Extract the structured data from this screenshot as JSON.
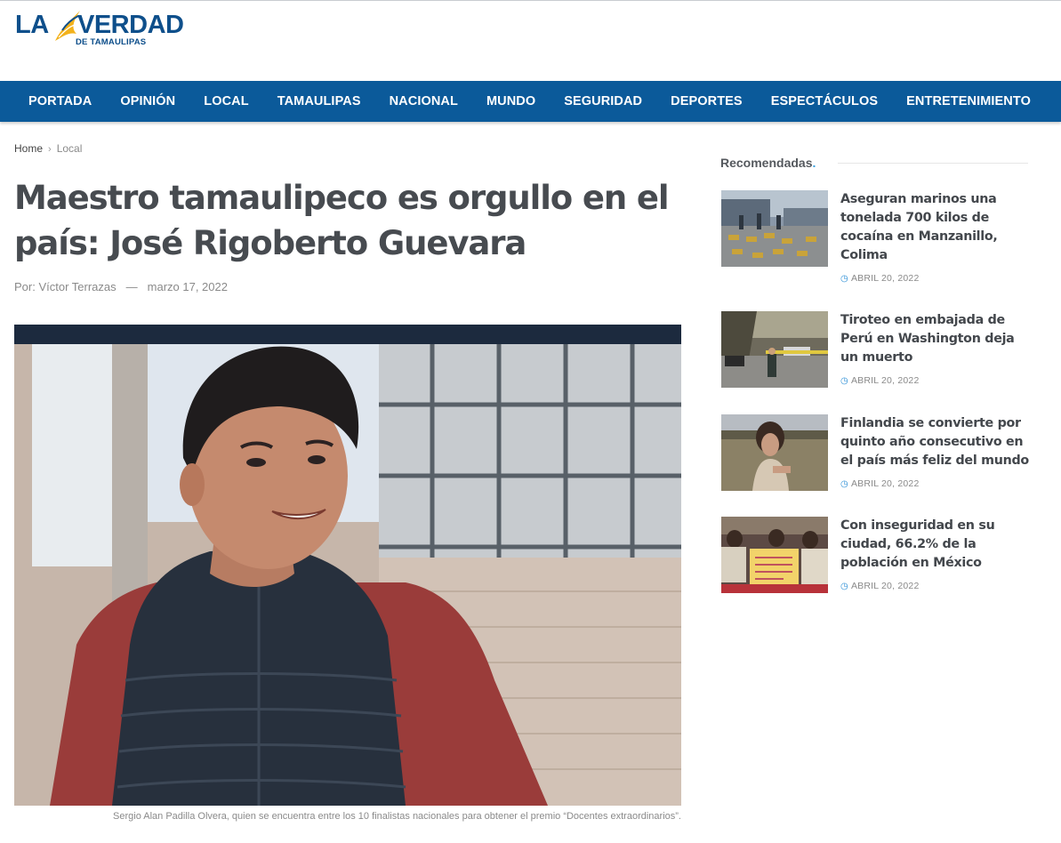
{
  "site": {
    "logo_la": "LA",
    "logo_verdad": "VERDAD",
    "logo_sub": "DE TAMAULIPAS"
  },
  "nav": {
    "items": [
      "PORTADA",
      "OPINIÓN",
      "LOCAL",
      "TAMAULIPAS",
      "NACIONAL",
      "MUNDO",
      "SEGURIDAD",
      "DEPORTES",
      "ESPECTÁCULOS",
      "ENTRETENIMIENTO"
    ]
  },
  "breadcrumb": {
    "home": "Home",
    "separator": "›",
    "current": "Local"
  },
  "article": {
    "title": "Maestro tamaulipeco es orgullo en el país: José Rigoberto Guevara",
    "author": "Por: Víctor Terrazas",
    "dash": "—",
    "date": "marzo 17, 2022",
    "caption": "Sergio Alan Padilla Olvera, quien se encuentra entre los 10 finalistas nacionales para obtener el premio “Docentes extraordinarios”."
  },
  "sidebar": {
    "heading": "Recomendadas",
    "heading_dot": ".",
    "items": [
      {
        "title": "Aseguran marinos una tonelada 700 kilos de cocaína en Manzanillo, Colima",
        "date": "ABRIL 20, 2022"
      },
      {
        "title": "Tiroteo en embajada de Perú en Washington deja un muerto",
        "date": "ABRIL 20, 2022"
      },
      {
        "title": "Finlandia se convierte por quinto año consecutivo en el país más feliz del mundo",
        "date": "ABRIL 20, 2022"
      },
      {
        "title": "Con inseguridad en su ciudad, 66.2% de la población en México",
        "date": "ABRIL 20, 2022"
      }
    ]
  },
  "colors": {
    "brand_blue": "#0b5a9a",
    "logo_blue": "#0e4f8b",
    "logo_gold": "#f3b21b",
    "accent": "#2c8fd6"
  }
}
